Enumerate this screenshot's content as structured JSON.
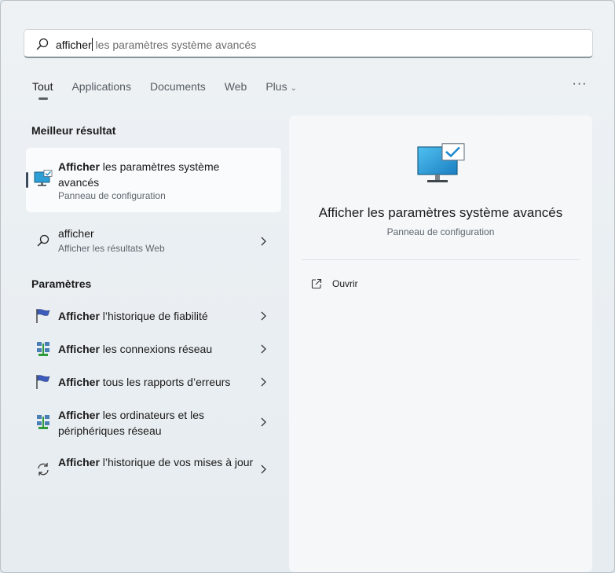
{
  "search": {
    "typed": "afficher",
    "suggestion": " les paramètres système avancés"
  },
  "tabs": [
    {
      "label": "Tout"
    },
    {
      "label": "Applications"
    },
    {
      "label": "Documents"
    },
    {
      "label": "Web"
    },
    {
      "label": "Plus"
    }
  ],
  "more_label": "···",
  "best_match": {
    "section": "Meilleur résultat",
    "bold": "Afficher",
    "rest": " les paramètres système avancés",
    "subtitle": "Panneau de configuration",
    "icon": "system-settings-monitor-icon"
  },
  "web_result": {
    "title": "afficher",
    "subtitle": "Afficher les résultats Web",
    "icon": "search-icon"
  },
  "settings": {
    "section": "Paramètres",
    "items": [
      {
        "bold": "Afficher",
        "rest": " l’historique de fiabilité",
        "icon": "reliability-flag-icon"
      },
      {
        "bold": "Afficher",
        "rest": " les connexions réseau",
        "icon": "network-icon"
      },
      {
        "bold": "Afficher",
        "rest": " tous les rapports d’erreurs",
        "icon": "error-report-flag-icon"
      },
      {
        "bold": "Afficher",
        "rest": " les ordinateurs et les périphériques réseau",
        "icon": "network-devices-icon"
      },
      {
        "bold": "Afficher",
        "rest": " l’historique de vos mises à jour",
        "icon": "update-sync-icon"
      }
    ]
  },
  "preview": {
    "title": "Afficher les paramètres système avancés",
    "subtitle": "Panneau de configuration",
    "action_open": "Ouvrir"
  }
}
